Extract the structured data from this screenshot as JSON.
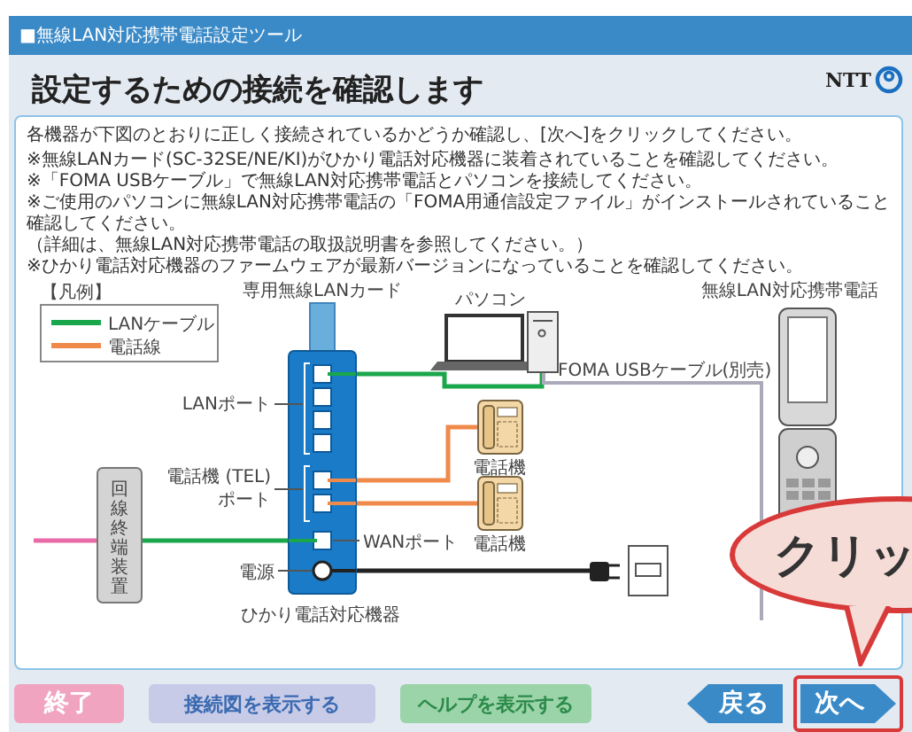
{
  "window": {
    "title": "■無線LAN対応携帯電話設定ツール"
  },
  "header": {
    "heading": "設定するための接続を確認します",
    "logo": "NTT"
  },
  "instructions": {
    "lead": "各機器が下図のとおりに正しく接続されているかどうか確認し、[次へ]をクリックしてください。",
    "notes": [
      "※無線LANカード(SC-32SE/NE/KI)がひかり電話対応機器に装着されていることを確認してください。",
      "※「FOMA USBケーブル」で無線LAN対応携帯電話とパソコンを接続してください。",
      "※ご使用のパソコンに無線LAN対応携帯電話の「FOMA用通信設定ファイル」がインストールされていること確認してください。",
      "（詳細は、無線LAN対応携帯電話の取扱説明書を参照してください。）",
      "※ひかり電話対応機器のファームウェアが最新バージョンになっていることを確認してください。"
    ]
  },
  "diagram": {
    "legend_title": "【凡例】",
    "legend": [
      {
        "label": "LANケーブル",
        "color": "#1aa64a"
      },
      {
        "label": "電話線",
        "color": "#f08a4b"
      }
    ],
    "card_label": "専用無線LANカード",
    "router_label": "ひかり電話対応機器",
    "lan_port_label": "LANポート",
    "tel_port_label": [
      "電話機 (TEL)",
      "ポート"
    ],
    "wan_port_label": "WANポート",
    "power_label": "電源",
    "onu_label": "回線終端装置",
    "pc_label": "パソコン",
    "phone_labels": [
      "電話機",
      "電話機"
    ],
    "usb_cable_label": "FOMA USBケーブル(別売)",
    "mobile_label": "無線LAN対応携帯電話"
  },
  "callout": {
    "text": "クリッ"
  },
  "buttons": [
    {
      "label": "終了",
      "kind": "exit",
      "highlighted": false
    },
    {
      "label": "接続図を表示する",
      "kind": "diagram",
      "highlighted": false
    },
    {
      "label": "ヘルプを表示する",
      "kind": "help",
      "highlighted": false
    },
    {
      "label": "戻る",
      "kind": "back",
      "highlighted": false
    },
    {
      "label": "次へ",
      "kind": "next",
      "highlighted": true
    }
  ]
}
